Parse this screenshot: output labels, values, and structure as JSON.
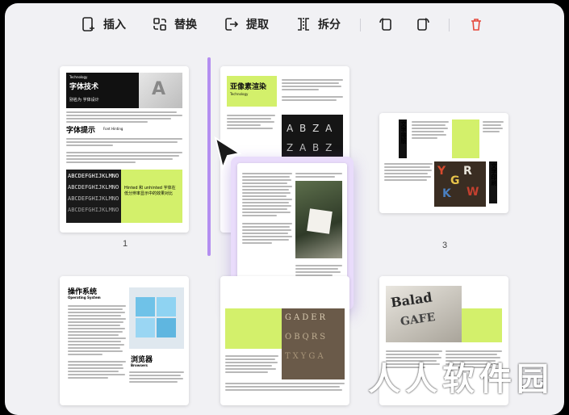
{
  "toolbar": {
    "insert": "插入",
    "replace": "替换",
    "extract": "提取",
    "split": "拆分"
  },
  "pages": {
    "p1": {
      "number": "1",
      "tag": "Technology",
      "title": "字体技术",
      "subtitle": "别名为 字体设计",
      "section": "字体提示",
      "section_en": "Font Hinting",
      "sample": "ABCDEFGHIJKLMNO",
      "caption": "Hinted 和 unhinted 字体在低分辨率显示中的效果对比"
    },
    "p2": {
      "title": "亚像素渲染",
      "tag": "Technology"
    },
    "p3": {
      "number": "3",
      "title_a": "文字排版",
      "title_b": "文字印刷"
    },
    "p4": {
      "title": "操作系统",
      "tag": "Operating System",
      "section": "浏览器",
      "section_en": "Browsers"
    }
  },
  "watermark": "人人软件园",
  "colors": {
    "accent": "#d3f06b",
    "drag": "#b48ef0",
    "delete": "#e5483b"
  }
}
